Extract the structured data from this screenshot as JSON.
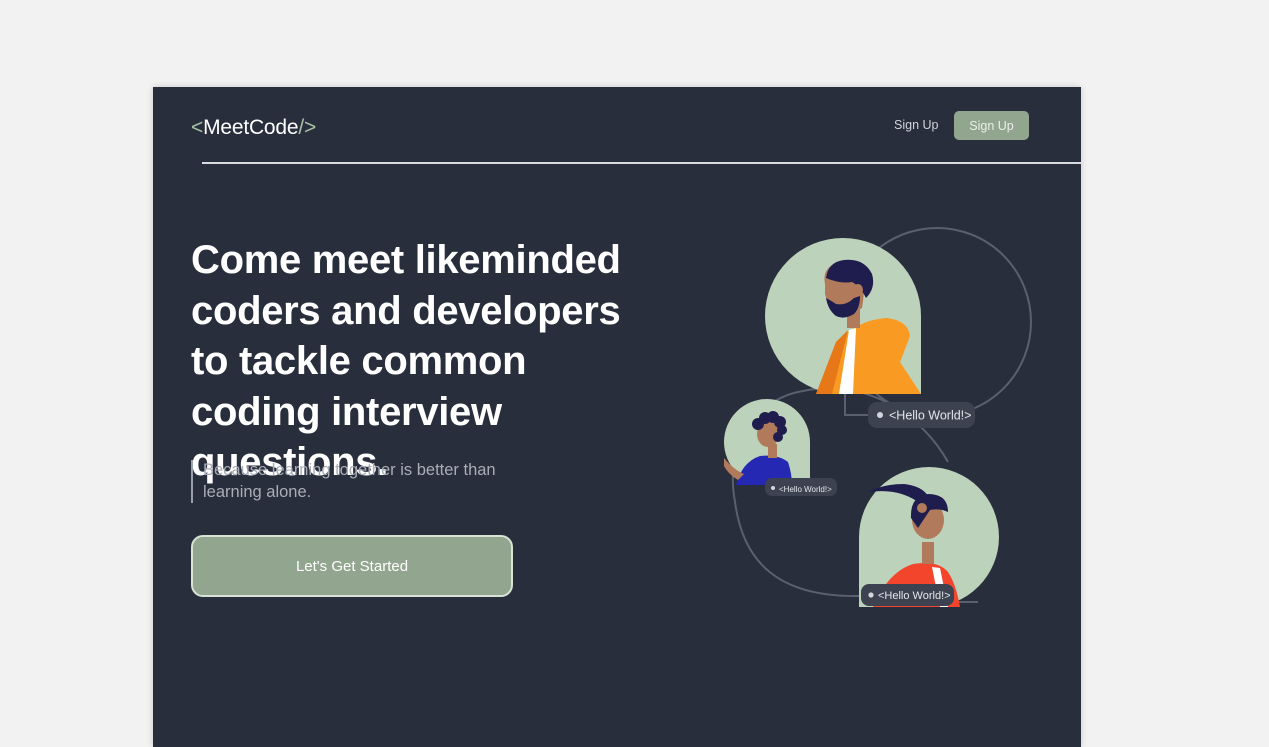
{
  "header": {
    "logo_open": "<",
    "logo_name": "MeetCode",
    "logo_close": "/>",
    "nav_link_label": "Sign Up",
    "nav_button_label": "Sign Up"
  },
  "hero": {
    "headline": "Come meet likeminded coders and developers to tackle common coding interview questions.",
    "subtext": "Because learning together is better than learning alone.",
    "cta_label": "Let's Get Started"
  },
  "illustration": {
    "bubble_1": "<Hello World!>",
    "bubble_2": "<Hello World!>",
    "bubble_3": "<Hello World!>"
  },
  "colors": {
    "background": "#282e3b",
    "accent": "#92a68f",
    "avatar_bg": "#bdd2bb"
  }
}
